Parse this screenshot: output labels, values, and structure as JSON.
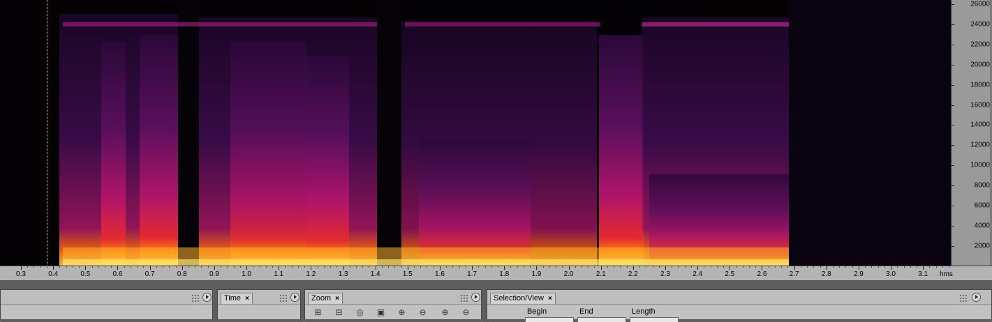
{
  "time_axis": {
    "labels": [
      "0.3",
      "0.4",
      "0.5",
      "0.6",
      "0.7",
      "0.8",
      "0.9",
      "1.0",
      "1.1",
      "1.2",
      "1.3",
      "1.4",
      "1.5",
      "1.6",
      "1.7",
      "1.8",
      "1.9",
      "2.0",
      "2.1",
      "2.2",
      "2.3",
      "2.4",
      "2.5",
      "2.6",
      "2.7",
      "2.8",
      "2.9",
      "3.0",
      "3.1"
    ],
    "unit": "hms"
  },
  "freq_axis": {
    "labels": [
      "26000",
      "24000",
      "22000",
      "20000",
      "18000",
      "16000",
      "14000",
      "12000",
      "10000",
      "8000",
      "6000",
      "4000",
      "2000"
    ]
  },
  "panels": {
    "time": {
      "title": "Time",
      "close": "×"
    },
    "zoom": {
      "title": "Zoom",
      "close": "×"
    },
    "selection": {
      "title": "Selection/View",
      "close": "×",
      "begin": "Begin",
      "end": "End",
      "length": "Length"
    }
  },
  "colors": {
    "spectrum_low": "#3a0a44",
    "spectrum_mid": "#c21a5c",
    "spectrum_high": "#ff7a10",
    "spectrum_peak": "#ffe860",
    "playhead": "#e8c41a"
  }
}
